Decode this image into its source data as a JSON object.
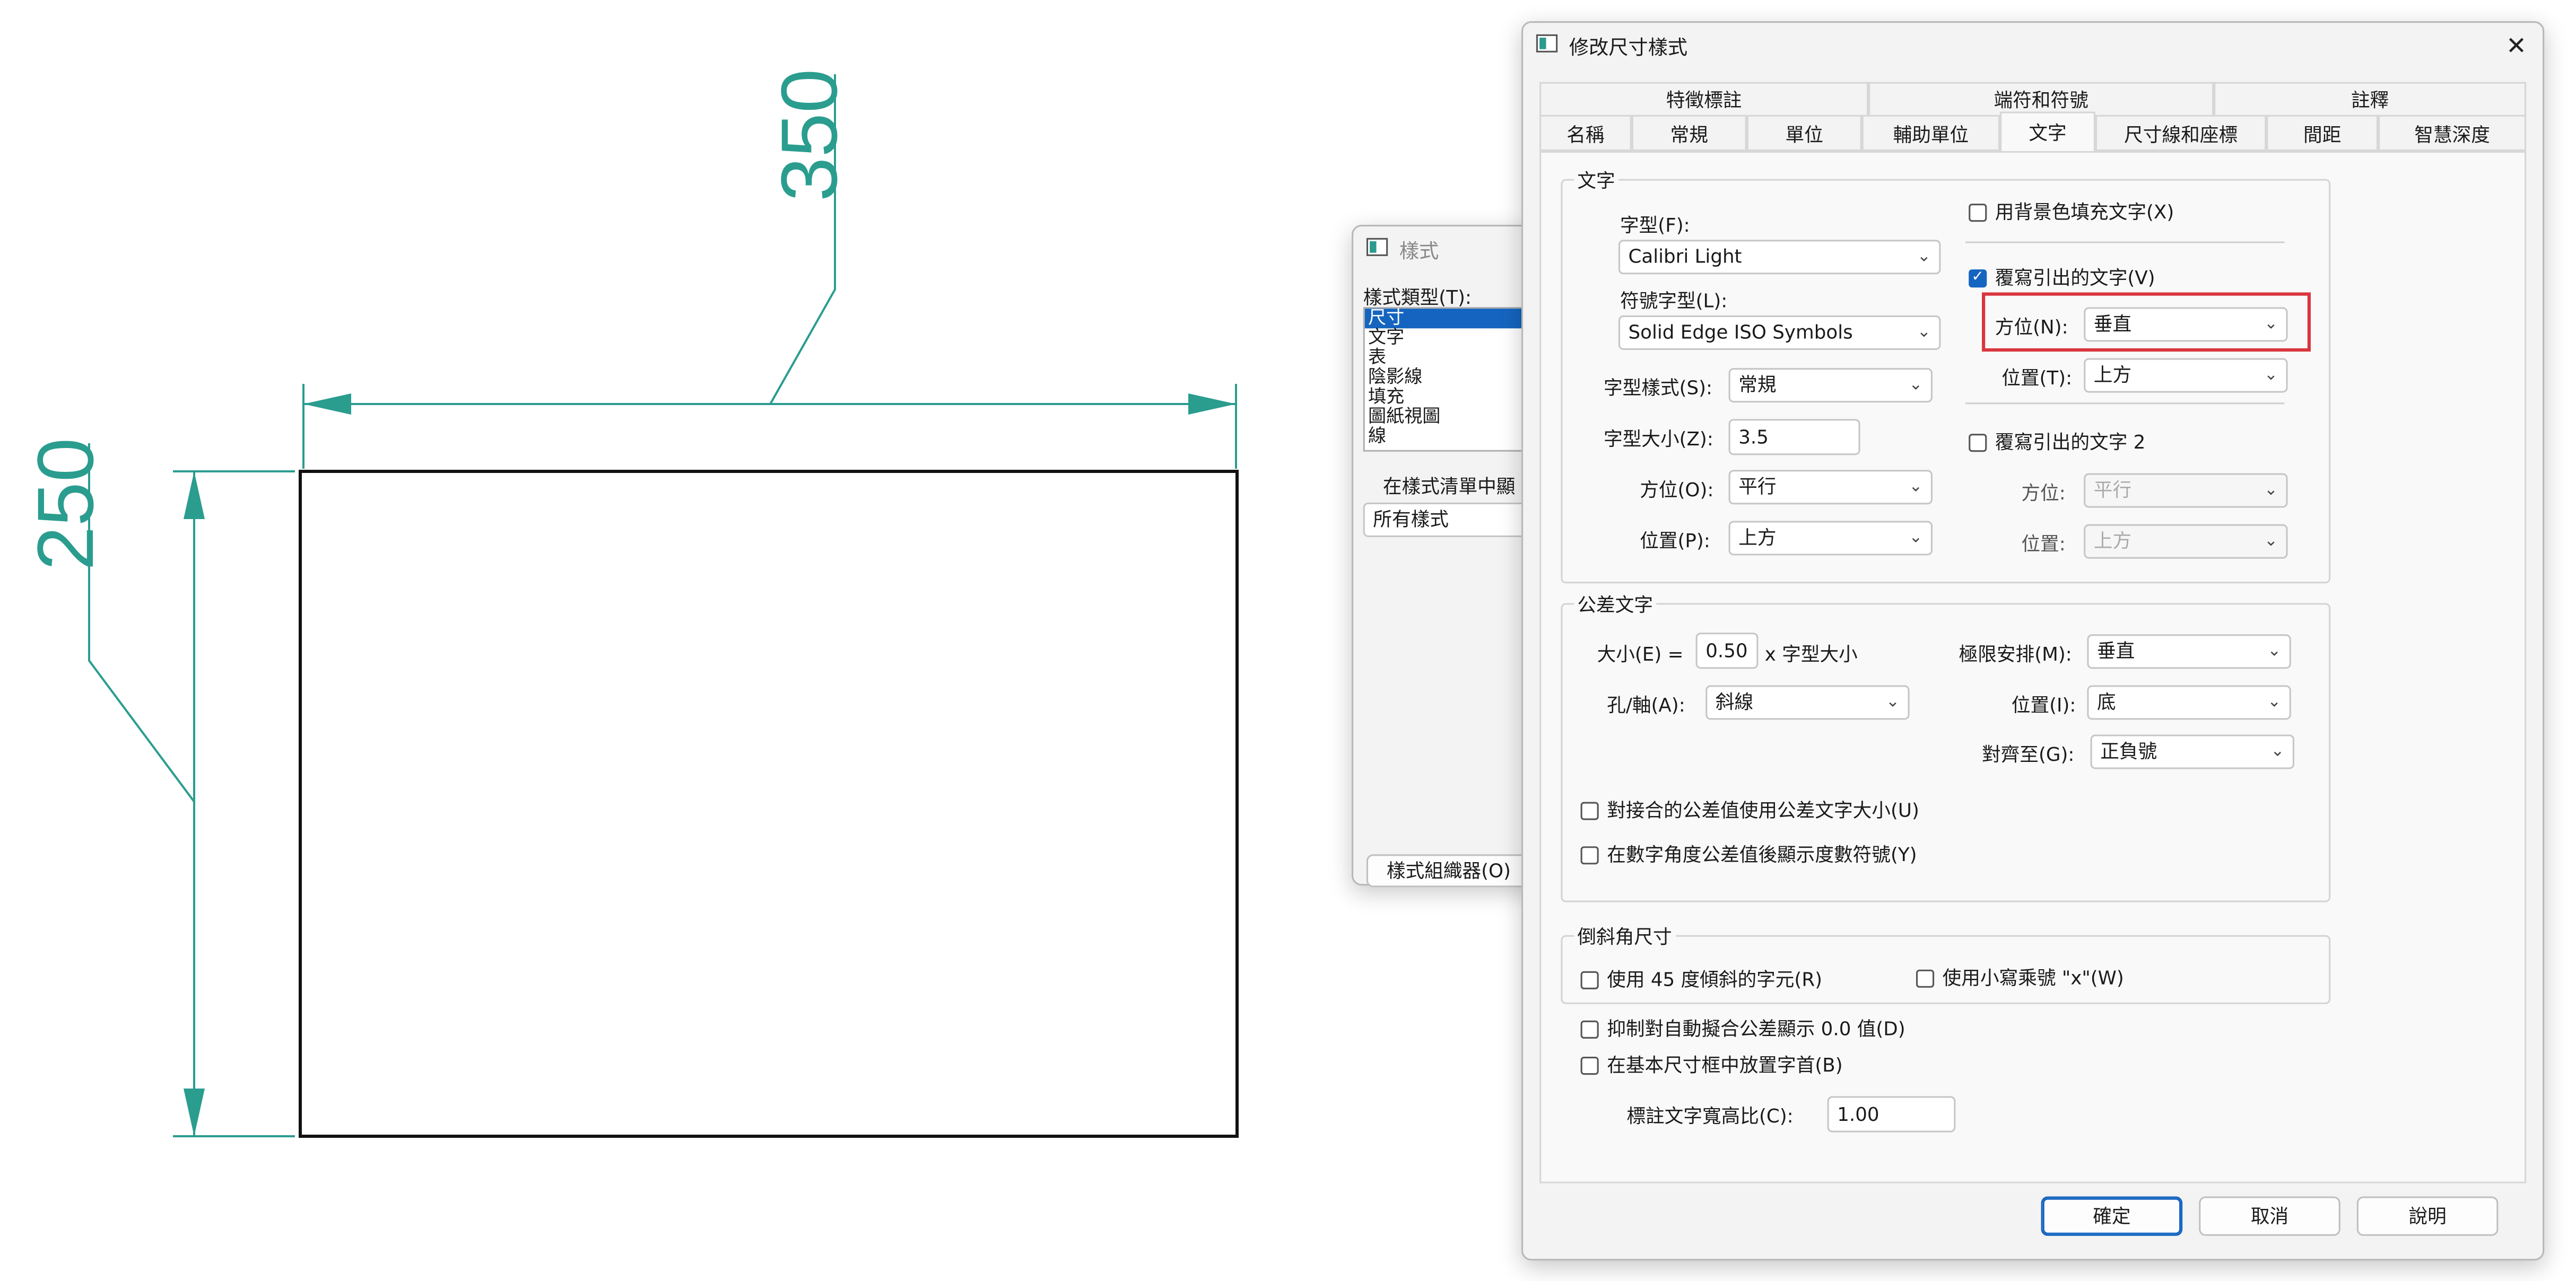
{
  "drawing": {
    "dim_horizontal": "350",
    "dim_vertical": "250",
    "color_dim": "#2a9d8f"
  },
  "styles_dialog": {
    "title": "樣式",
    "type_label": "樣式類型(T):",
    "types": [
      "尺寸",
      "文字",
      "表",
      "陰影線",
      "填充",
      "圖紙視圖",
      "線"
    ],
    "list_label": "在樣式清單中顯",
    "list_value": "所有樣式",
    "organizer_button": "樣式組織器(O)"
  },
  "main_dialog": {
    "title": "修改尺寸樣式",
    "close": "✕",
    "tabs_row1": [
      "特徵標註",
      "端符和符號",
      "註釋"
    ],
    "tabs_row2": [
      "名稱",
      "常規",
      "單位",
      "輔助單位",
      "文字",
      "尺寸線和座標",
      "間距",
      "智慧深度"
    ],
    "active_tab": "文字",
    "text_group": {
      "title": "文字",
      "font_label": "字型(F):",
      "font_value": "Calibri Light",
      "symbol_font_label": "符號字型(L):",
      "symbol_font_value": "Solid Edge ISO Symbols",
      "font_style_label": "字型樣式(S):",
      "font_style_value": "常規",
      "font_size_label": "字型大小(Z):",
      "font_size_value": "3.5",
      "orientation_label": "方位(O):",
      "orientation_value": "平行",
      "position_label": "位置(P):",
      "position_value": "上方",
      "bg_fill_label": "用背景色填充文字(X)",
      "override_leader_label": "覆寫引出的文字(V)",
      "override_orientation_label": "方位(N):",
      "override_orientation_value": "垂直",
      "override_position_label": "位置(T):",
      "override_position_value": "上方",
      "override_leader2_label": "覆寫引出的文字 2",
      "o2_orientation_label": "方位:",
      "o2_orientation_value": "平行",
      "o2_position_label": "位置:",
      "o2_position_value": "上方"
    },
    "tolerance_group": {
      "title": "公差文字",
      "size_label": "大小(E) =",
      "size_value": "0.50",
      "size_suffix": "x 字型大小",
      "hole_shaft_label": "孔/軸(A):",
      "hole_shaft_value": "斜線",
      "limit_label": "極限安排(M):",
      "limit_value": "垂直",
      "tol_position_label": "位置(I):",
      "tol_position_value": "底",
      "align_label": "對齊至(G):",
      "align_value": "正負號",
      "cb1_label": "對接合的公差值使用公差文字大小(U)",
      "cb2_label": "在數字角度公差值後顯示度數符號(Y)"
    },
    "chamfer_group": {
      "title": "倒斜角尺寸",
      "cb_45_label": "使用 45 度傾斜的字元(R)",
      "cb_times_label": "使用小寫乘號 \"x\"(W)"
    },
    "suppress_zero_label": "抑制對自動擬合公差顯示 0.0 值(D)",
    "prefix_in_box_label": "在基本尺寸框中放置字首(B)",
    "aspect_label": "標註文字寬高比(C):",
    "aspect_value": "1.00",
    "ok_button": "確定",
    "cancel_button": "取消",
    "help_button": "說明",
    "highlight_color": "#d9363e"
  }
}
